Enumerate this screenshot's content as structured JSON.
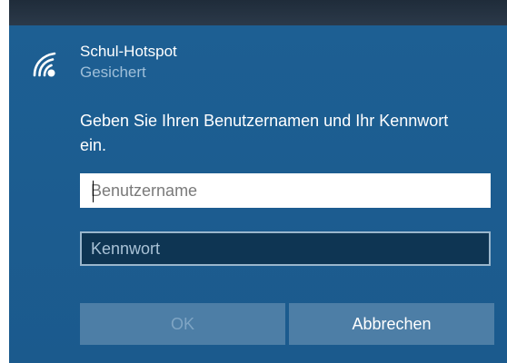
{
  "network": {
    "name": "Schul-Hotspot",
    "status": "Gesichert",
    "icon": "wifi-secured-icon"
  },
  "prompt": "Geben Sie Ihren Benutzernamen und Ihr Kennwort ein.",
  "username_field": {
    "placeholder": "Benutzername",
    "value": ""
  },
  "password_field": {
    "placeholder": "Kennwort",
    "value": ""
  },
  "buttons": {
    "ok_label": "OK",
    "cancel_label": "Abbrechen"
  },
  "colors": {
    "panel_background": "#1b5a8d",
    "button_background": "#4d7ea6",
    "disabled_text": "#7fa5c4"
  }
}
